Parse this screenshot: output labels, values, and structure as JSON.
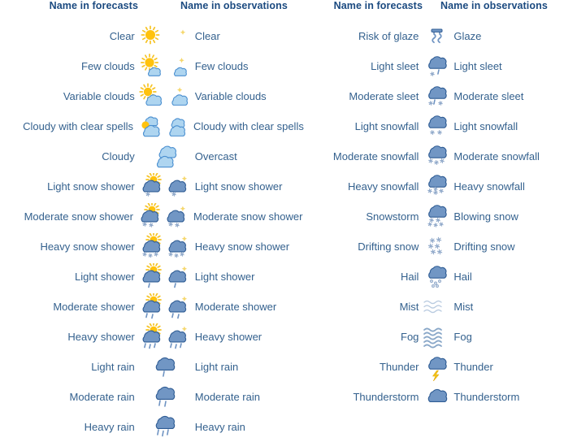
{
  "colors": {
    "header_text": "#1b4a80",
    "body_text": "#34618e",
    "sun": "#ffc20e",
    "sun_ray": "#f6c324",
    "moon": "#f5d76e",
    "cloud_light": "#aed5f0",
    "cloud_light_stroke": "#4a8fd0",
    "cloud_dark": "#7196c4",
    "cloud_dark_stroke": "#2f5c94",
    "precip": "#6e93c2",
    "snow": "#8fa8c9",
    "lightning": "#f5c518",
    "background": "#ffffff"
  },
  "columns": {
    "forecasts_header": "Name in forecasts",
    "observations_header": "Name in observations"
  },
  "left_panel": {
    "header": {
      "forecasts": "Name in forecasts",
      "observations": "Name in observations"
    },
    "rows": [
      {
        "forecast": "Clear",
        "observation": "Clear",
        "day_icon": "sun",
        "night_icon": "moon"
      },
      {
        "forecast": "Few clouds",
        "observation": "Few clouds",
        "day_icon": "sun-few-clouds",
        "night_icon": "moon-few-clouds"
      },
      {
        "forecast": "Variable clouds",
        "observation": "Variable clouds",
        "day_icon": "sun-variable-clouds",
        "night_icon": "moon-variable-clouds"
      },
      {
        "forecast": "Cloudy with clear spells",
        "observation": "Cloudy with clear spells",
        "day_icon": "sun-cloudy-spells",
        "night_icon": "moon-cloudy-spells"
      },
      {
        "forecast": "Cloudy",
        "observation": "Overcast",
        "day_icon": "overcast",
        "night_icon": null
      },
      {
        "forecast": "Light snow shower",
        "observation": "Light snow shower",
        "day_icon": "sun-light-snow-shower",
        "night_icon": "moon-light-snow-shower"
      },
      {
        "forecast": "Moderate snow shower",
        "observation": "Moderate snow shower",
        "day_icon": "sun-moderate-snow-shower",
        "night_icon": "moon-moderate-snow-shower"
      },
      {
        "forecast": "Heavy snow shower",
        "observation": "Heavy snow shower",
        "day_icon": "sun-heavy-snow-shower",
        "night_icon": "moon-heavy-snow-shower"
      },
      {
        "forecast": "Light shower",
        "observation": "Light shower",
        "day_icon": "sun-light-shower",
        "night_icon": "moon-light-shower"
      },
      {
        "forecast": "Moderate shower",
        "observation": "Moderate shower",
        "day_icon": "sun-moderate-shower",
        "night_icon": "moon-moderate-shower"
      },
      {
        "forecast": "Heavy shower",
        "observation": "Heavy shower",
        "day_icon": "sun-heavy-shower",
        "night_icon": "moon-heavy-shower"
      },
      {
        "forecast": "Light rain",
        "observation": "Light rain",
        "day_icon": "light-rain",
        "night_icon": null
      },
      {
        "forecast": "Moderate rain",
        "observation": "Moderate rain",
        "day_icon": "moderate-rain",
        "night_icon": null
      },
      {
        "forecast": "Heavy rain",
        "observation": "Heavy rain",
        "day_icon": "heavy-rain",
        "night_icon": null
      }
    ]
  },
  "right_panel": {
    "header": {
      "forecasts": "Name in forecasts",
      "observations": "Name in observations"
    },
    "rows": [
      {
        "forecast": "Risk of glaze",
        "observation": "Glaze",
        "icon": "glaze"
      },
      {
        "forecast": "Light sleet",
        "observation": "Light sleet",
        "icon": "light-sleet"
      },
      {
        "forecast": "Moderate sleet",
        "observation": "Moderate sleet",
        "icon": "moderate-sleet"
      },
      {
        "forecast": "Light snowfall",
        "observation": "Light snowfall",
        "icon": "light-snowfall"
      },
      {
        "forecast": "Moderate snowfall",
        "observation": "Moderate snowfall",
        "icon": "moderate-snowfall"
      },
      {
        "forecast": "Heavy snowfall",
        "observation": "Heavy snowfall",
        "icon": "heavy-snowfall"
      },
      {
        "forecast": "Snowstorm",
        "observation": "Blowing snow",
        "icon": "snowstorm"
      },
      {
        "forecast": "Drifting snow",
        "observation": "Drifting snow",
        "icon": "drifting-snow"
      },
      {
        "forecast": "Hail",
        "observation": "Hail",
        "icon": "hail"
      },
      {
        "forecast": "Mist",
        "observation": "Mist",
        "icon": "mist"
      },
      {
        "forecast": "Fog",
        "observation": "Fog",
        "icon": "fog"
      },
      {
        "forecast": "Thunder",
        "observation": "Thunder",
        "icon": "thunder"
      },
      {
        "forecast": "Thunderstorm",
        "observation": "Thunderstorm",
        "icon": "thunderstorm"
      }
    ]
  }
}
